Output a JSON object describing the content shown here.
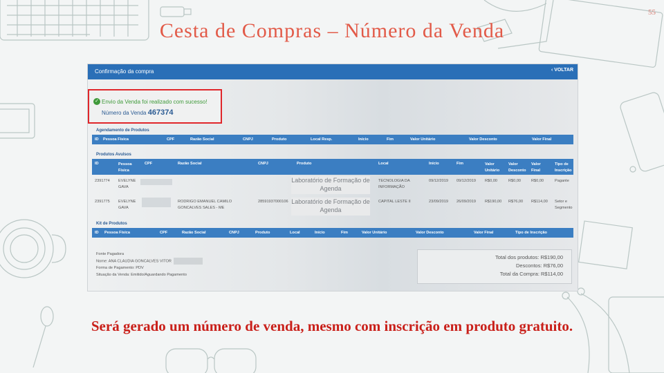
{
  "slide": {
    "title": "Cesta de Compras – Número da Venda",
    "page_number": "55",
    "caption": "Será gerado um número de venda, mesmo com inscrição em produto gratuito."
  },
  "app": {
    "header_title": "Confirmação da compra",
    "back_label": "‹ VOLTAR",
    "success_message": "Envio da Venda foi realizado com sucesso!",
    "sale_number_label": "Número da Venda",
    "sale_number": "467374"
  },
  "agendamento": {
    "title": "Agendamento de Produtos",
    "headers": [
      "ID",
      "Pessoa Física",
      "CPF",
      "Razão Social",
      "CNPJ",
      "Produto",
      "Local Resp.",
      "Início",
      "Fim",
      "Valor Unitário",
      "Valor Desconto",
      "Valor Final"
    ]
  },
  "avulsos": {
    "title": "Produtos Avulsos",
    "headers": [
      "ID",
      "Pessoa Física",
      "CPF",
      "Razão Social",
      "CNPJ",
      "Produto",
      "Local",
      "Início",
      "Fim",
      "Valor Unitário",
      "Valor Desconto",
      "Valor Final",
      "Tipo de Inscrição"
    ],
    "rows": [
      {
        "id": "2391774",
        "pessoa": "EVELYNE GAVA",
        "razao": "",
        "cnpj": "",
        "produto": "Laboratório de Formação de Agenda",
        "local": "TECNOLOGIA DA INFORMAÇÃO",
        "inicio": "09/12/2019",
        "fim": "09/12/2019",
        "unit": "R$0,00",
        "desc": "R$0,00",
        "final": "R$0,00",
        "tipo": "Pagante"
      },
      {
        "id": "2391775",
        "pessoa": "EVELYNE GAVA",
        "razao": "RODRIGO EMANUEL CAMILO GONCALVES SALES - ME",
        "cnpj": "28591937000106",
        "produto": "Laboratório de Formação de Agenda",
        "local": "CAPITAL LESTE II",
        "inicio": "23/09/2019",
        "fim": "26/09/2019",
        "unit": "R$190,00",
        "desc": "R$76,00",
        "final": "R$114,00",
        "tipo": "Setor e Segmento"
      }
    ]
  },
  "kit": {
    "title": "Kit de Produtos",
    "headers": [
      "ID",
      "Pessoa Física",
      "CPF",
      "Razão Social",
      "CNPJ",
      "Produto",
      "Local",
      "Início",
      "Fim",
      "Valor Unitário",
      "Valor Desconto",
      "Valor Final",
      "Tipo de Inscrição"
    ]
  },
  "footer": {
    "fonte": "Fonte Pagadora",
    "nome": "Nome: ANA CLAUDIA GONCALVES VITOR",
    "forma": "Forma de Pagamento: PDV",
    "situacao": "Situação da Venda: Emitido/Aguardando Pagamento"
  },
  "totals": {
    "produtos_label": "Total dos produtos:",
    "produtos_value": "R$190,00",
    "descontos_label": "Descontos:",
    "descontos_value": "R$76,00",
    "compra_label": "Total da Compra:",
    "compra_value": "R$114,00"
  },
  "colors": {
    "title": "#e25a48",
    "caption": "#c9201a",
    "header": "#2a6fb7",
    "highlight": "#e0262a",
    "success": "#3f9a3a"
  }
}
